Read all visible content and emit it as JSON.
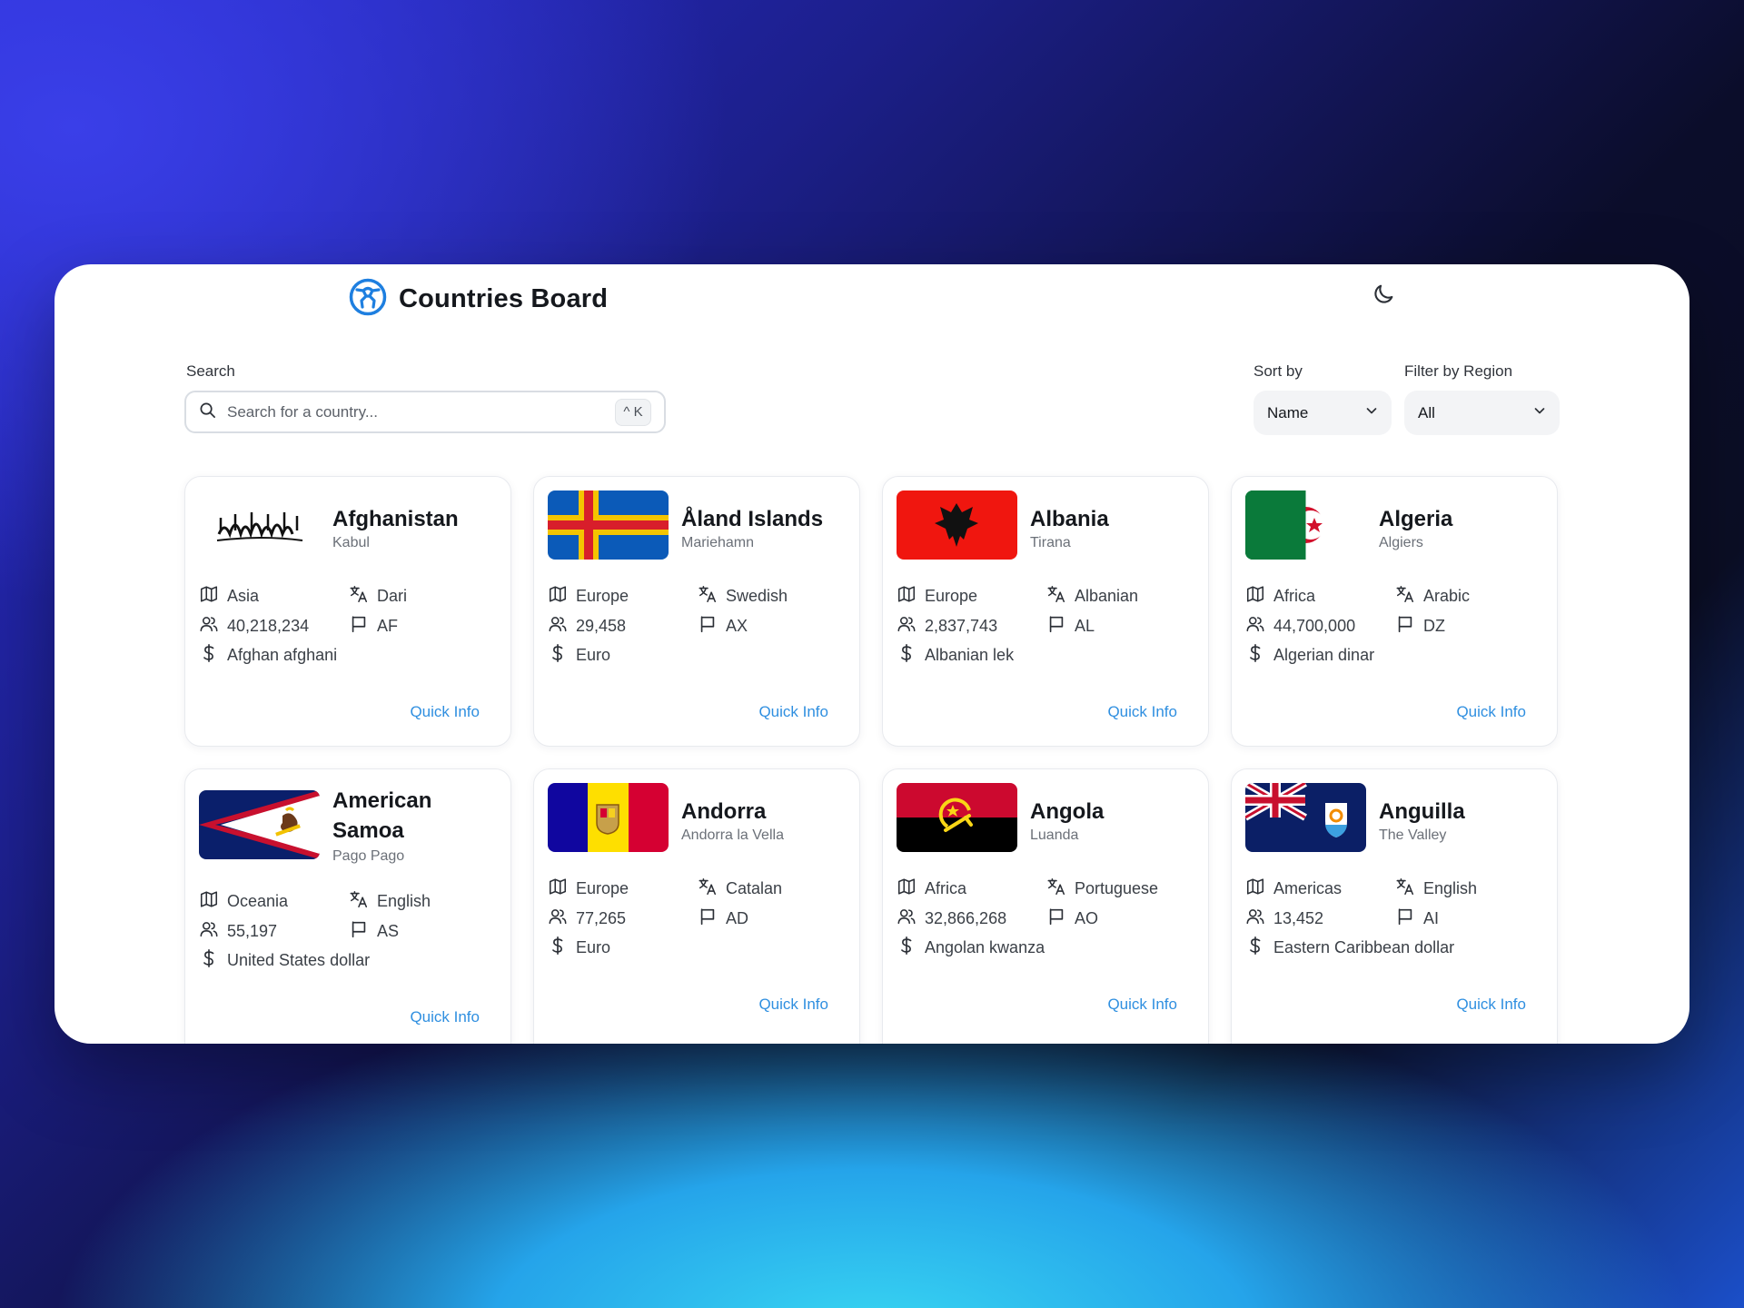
{
  "header": {
    "title": "Countries Board",
    "logo_icon": "globe-network-icon",
    "theme_icon": "moon-icon"
  },
  "controls": {
    "search_label": "Search",
    "search_placeholder": "Search for a country...",
    "search_value": "",
    "search_shortcut": "^ K",
    "sort_label": "Sort by",
    "sort_value": "Name",
    "filter_label": "Filter by Region",
    "filter_value": "All"
  },
  "colors": {
    "accent": "#2f8fe0",
    "logo": "#1e7fe0"
  },
  "countries": [
    {
      "name": "Afghanistan",
      "capital": "Kabul",
      "region": "Asia",
      "language": "Dari",
      "population": "40,218,234",
      "code": "AF",
      "currency": "Afghan afghani",
      "action": "Quick Info"
    },
    {
      "name": "Åland Islands",
      "capital": "Mariehamn",
      "region": "Europe",
      "language": "Swedish",
      "population": "29,458",
      "code": "AX",
      "currency": "Euro",
      "action": "Quick Info"
    },
    {
      "name": "Albania",
      "capital": "Tirana",
      "region": "Europe",
      "language": "Albanian",
      "population": "2,837,743",
      "code": "AL",
      "currency": "Albanian lek",
      "action": "Quick Info"
    },
    {
      "name": "Algeria",
      "capital": "Algiers",
      "region": "Africa",
      "language": "Arabic",
      "population": "44,700,000",
      "code": "DZ",
      "currency": "Algerian dinar",
      "action": "Quick Info"
    },
    {
      "name": "American Samoa",
      "capital": "Pago Pago",
      "region": "Oceania",
      "language": "English",
      "population": "55,197",
      "code": "AS",
      "currency": "United States dollar",
      "action": "Quick Info"
    },
    {
      "name": "Andorra",
      "capital": "Andorra la Vella",
      "region": "Europe",
      "language": "Catalan",
      "population": "77,265",
      "code": "AD",
      "currency": "Euro",
      "action": "Quick Info"
    },
    {
      "name": "Angola",
      "capital": "Luanda",
      "region": "Africa",
      "language": "Portuguese",
      "population": "32,866,268",
      "code": "AO",
      "currency": "Angolan kwanza",
      "action": "Quick Info"
    },
    {
      "name": "Anguilla",
      "capital": "The Valley",
      "region": "Americas",
      "language": "English",
      "population": "13,452",
      "code": "AI",
      "currency": "Eastern Caribbean dollar",
      "action": "Quick Info"
    }
  ]
}
